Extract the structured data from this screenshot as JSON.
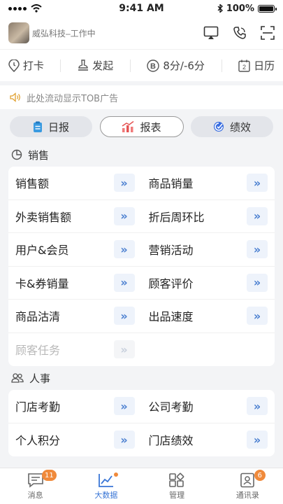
{
  "status_bar": {
    "time": "9:41 AM",
    "battery": "100%"
  },
  "header": {
    "company": "威弘科技–工作中"
  },
  "quick_actions": [
    {
      "label": "打卡",
      "icon": "location-pin-icon"
    },
    {
      "label": "发起",
      "icon": "stamp-icon"
    },
    {
      "label": "8分/-6分",
      "icon": "score-coin-icon"
    },
    {
      "label": "日历",
      "icon": "calendar-icon",
      "day": "2"
    }
  ],
  "ad_banner": {
    "text": "此处流动显示TOB广告"
  },
  "tabs": [
    {
      "label": "日报",
      "icon": "clipboard-icon"
    },
    {
      "label": "报表",
      "icon": "bar-chart-icon",
      "active": true
    },
    {
      "label": "绩效",
      "icon": "performance-icon"
    }
  ],
  "sections": [
    {
      "title": "销售",
      "rows": [
        [
          "销售额",
          "商品销量"
        ],
        [
          "外卖销售额",
          "折后周环比"
        ],
        [
          "用户&会员",
          "营销活动"
        ],
        [
          "卡&券销量",
          "顾客评价"
        ],
        [
          "商品沽清",
          "出品速度"
        ],
        [
          "顾客任务",
          ""
        ]
      ]
    },
    {
      "title": "人事",
      "rows": [
        [
          "门店考勤",
          "公司考勤"
        ],
        [
          "个人积分",
          "门店绩效"
        ]
      ]
    }
  ],
  "go_glyph": "»",
  "tab_bar": [
    {
      "label": "消息",
      "badge": "11"
    },
    {
      "label": "大数据",
      "active": true
    },
    {
      "label": "管理"
    },
    {
      "label": "通讯录",
      "badge": "6"
    }
  ],
  "colors": {
    "accent": "#3a76d6",
    "badge": "#f08a3b"
  }
}
